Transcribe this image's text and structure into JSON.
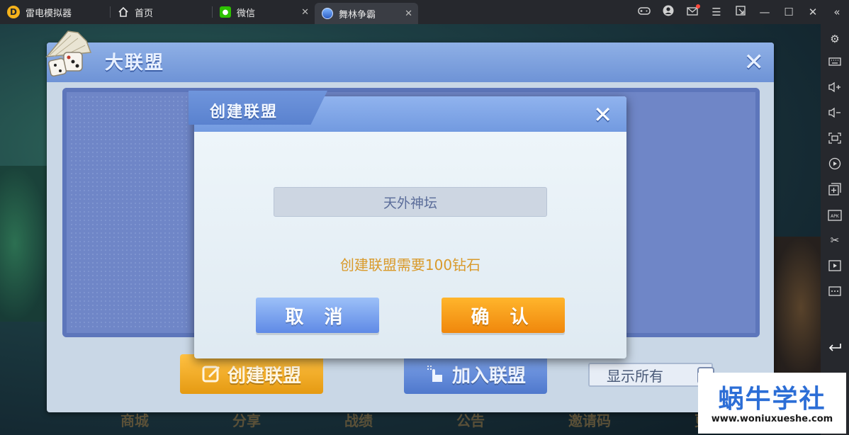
{
  "app": {
    "tabs": [
      {
        "label": "雷电模拟器",
        "icon": "leidian-logo-icon"
      },
      {
        "label": "首页",
        "icon": "home-icon"
      },
      {
        "label": "微信",
        "icon": "wechat-icon",
        "closable": true
      },
      {
        "label": "舞林争霸",
        "icon": "game-icon",
        "closable": true,
        "active": true
      }
    ],
    "close_glyph": "✕",
    "window_controls": [
      "gamepad-icon",
      "account-icon",
      "mail-icon",
      "menu-icon",
      "shrink-icon",
      "minimize-icon",
      "maximize-icon",
      "close-icon",
      "collapse-sidebar-icon"
    ]
  },
  "sidebar": {
    "items": [
      "settings-icon",
      "keyboard-icon",
      "volume-up-icon",
      "volume-down-icon",
      "screenshot-icon",
      "screen-record-icon",
      "multi-instance-icon",
      "install-apk-icon",
      "scissors-icon",
      "video-icon",
      "more-icon",
      "back-icon"
    ]
  },
  "game": {
    "alliance": {
      "title": "大联盟",
      "create_label": "创建联盟",
      "join_label": "加入联盟",
      "show_all_label": "显示所有",
      "bottom_nav": [
        "商城",
        "分享",
        "战绩",
        "公告",
        "邀请码",
        "更"
      ]
    },
    "modal": {
      "title": "创建联盟",
      "name_value": "天外神坛",
      "cost_text": "创建联盟需要100钻石",
      "cancel_label": "取 消",
      "confirm_label": "确 认"
    }
  },
  "watermark": {
    "cn": "蜗牛学社",
    "url": "www.woniuxueshe.com"
  },
  "colors": {
    "titlebar": "#26282d",
    "panel_header": "#7aa0e2",
    "confirm": "#f0870c",
    "cancel": "#5f8ae6",
    "cost_text": "#d99a2b",
    "watermark_text": "#2c6ed6"
  }
}
